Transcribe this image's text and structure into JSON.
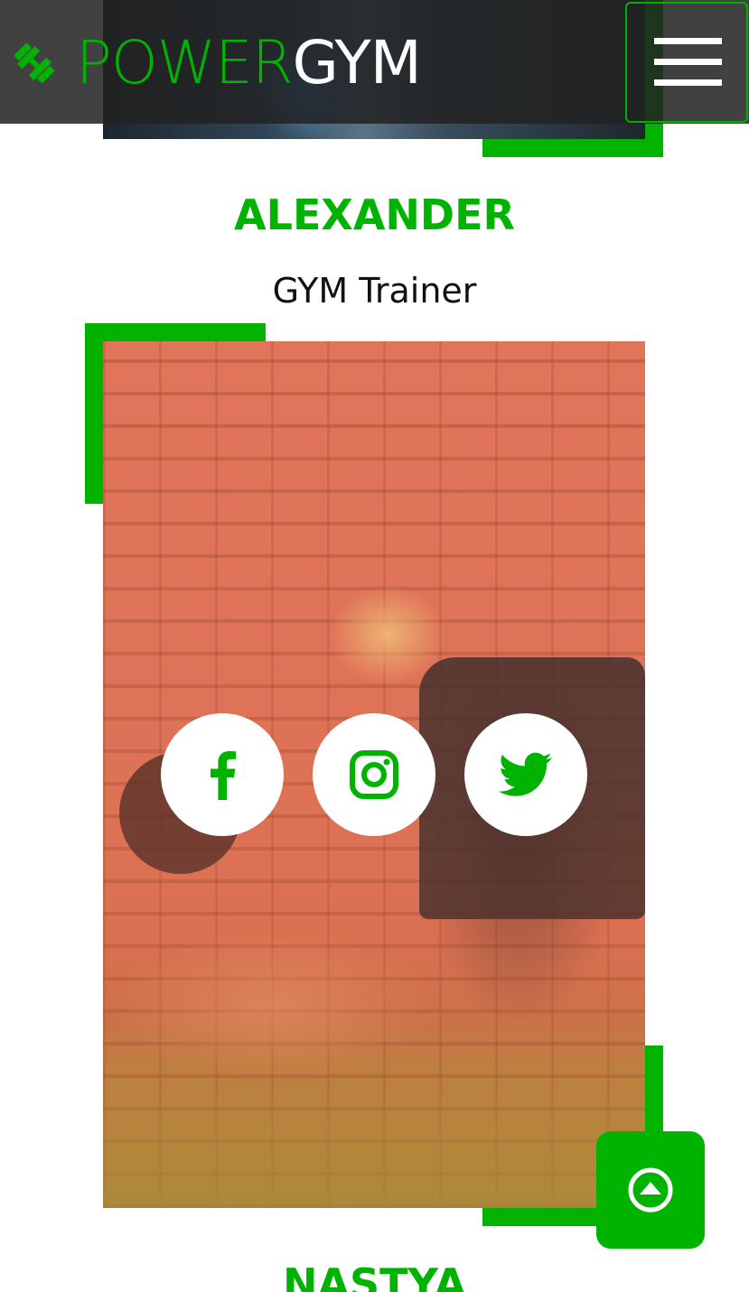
{
  "brand": {
    "power": "POWER",
    "gym": "GYM",
    "accent_color": "#00b300",
    "logo_icon": "dumbbell-icon"
  },
  "header": {
    "menu_icon": "hamburger-menu-icon"
  },
  "trainer": {
    "name": "ALEXANDER",
    "role": "GYM Trainer",
    "social": [
      {
        "network": "facebook",
        "icon": "facebook-icon"
      },
      {
        "network": "instagram",
        "icon": "instagram-icon"
      },
      {
        "network": "twitter",
        "icon": "twitter-icon"
      }
    ]
  },
  "next_trainer": {
    "name": "NASTYA"
  },
  "scroll_top": {
    "icon": "arrow-up-circle-icon"
  }
}
